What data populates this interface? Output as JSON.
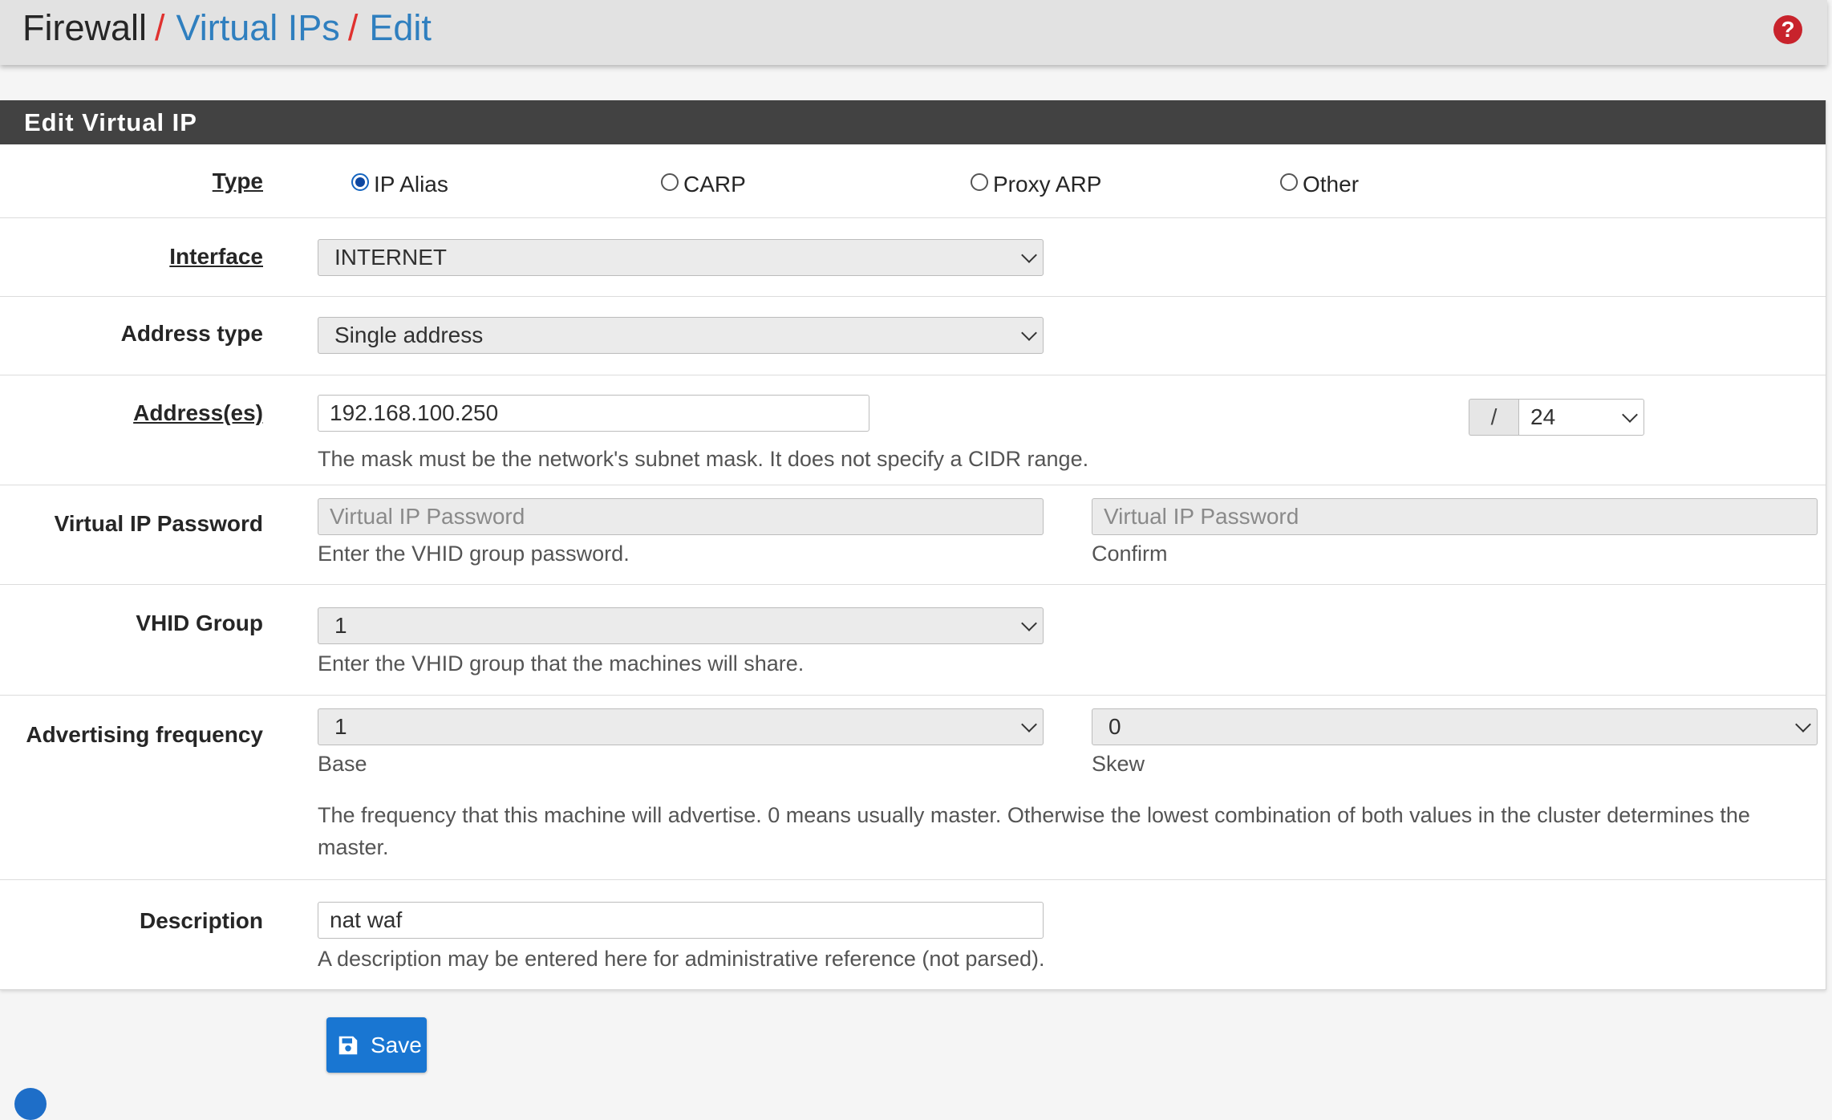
{
  "breadcrumb": {
    "root": "Firewall",
    "separator": "/",
    "items": [
      "Virtual IPs",
      "Edit"
    ]
  },
  "help_icon": "question-circle-icon",
  "panel": {
    "title": "Edit Virtual IP"
  },
  "form": {
    "type": {
      "label": "Type",
      "options": [
        "IP Alias",
        "CARP",
        "Proxy ARP",
        "Other"
      ],
      "selected": "IP Alias"
    },
    "interface": {
      "label": "Interface",
      "value": "INTERNET"
    },
    "address_type": {
      "label": "Address type",
      "value": "Single address"
    },
    "addresses": {
      "label": "Address(es)",
      "value": "192.168.100.250",
      "mask_separator": "/",
      "mask": "24",
      "help": "The mask must be the network's subnet mask. It does not specify a CIDR range."
    },
    "vip_password": {
      "label": "Virtual IP Password",
      "placeholder": "Virtual IP Password",
      "confirm_placeholder": "Virtual IP Password",
      "help": "Enter the VHID group password.",
      "confirm_help": "Confirm"
    },
    "vhid_group": {
      "label": "VHID Group",
      "value": "1",
      "help": "Enter the VHID group that the machines will share."
    },
    "advertising_frequency": {
      "label": "Advertising frequency",
      "base_value": "1",
      "base_help": "Base",
      "skew_value": "0",
      "skew_help": "Skew",
      "help_line1": "The frequency that this machine will advertise. 0 means usually master. Otherwise the lowest combination of both values in the cluster determines the",
      "help_line2": "master."
    },
    "description": {
      "label": "Description",
      "value": "nat waf",
      "help": "A description may be entered here for administrative reference (not parsed)."
    }
  },
  "actions": {
    "save_label": "Save",
    "save_icon": "floppy-disk-icon"
  },
  "colors": {
    "header_bg": "#e2e2e2",
    "panel_heading_bg": "#424242",
    "link": "#2f7fbf",
    "breadcrumb_sep": "#e0312f",
    "primary_button": "#1976d2",
    "help_icon": "#c8232c"
  }
}
